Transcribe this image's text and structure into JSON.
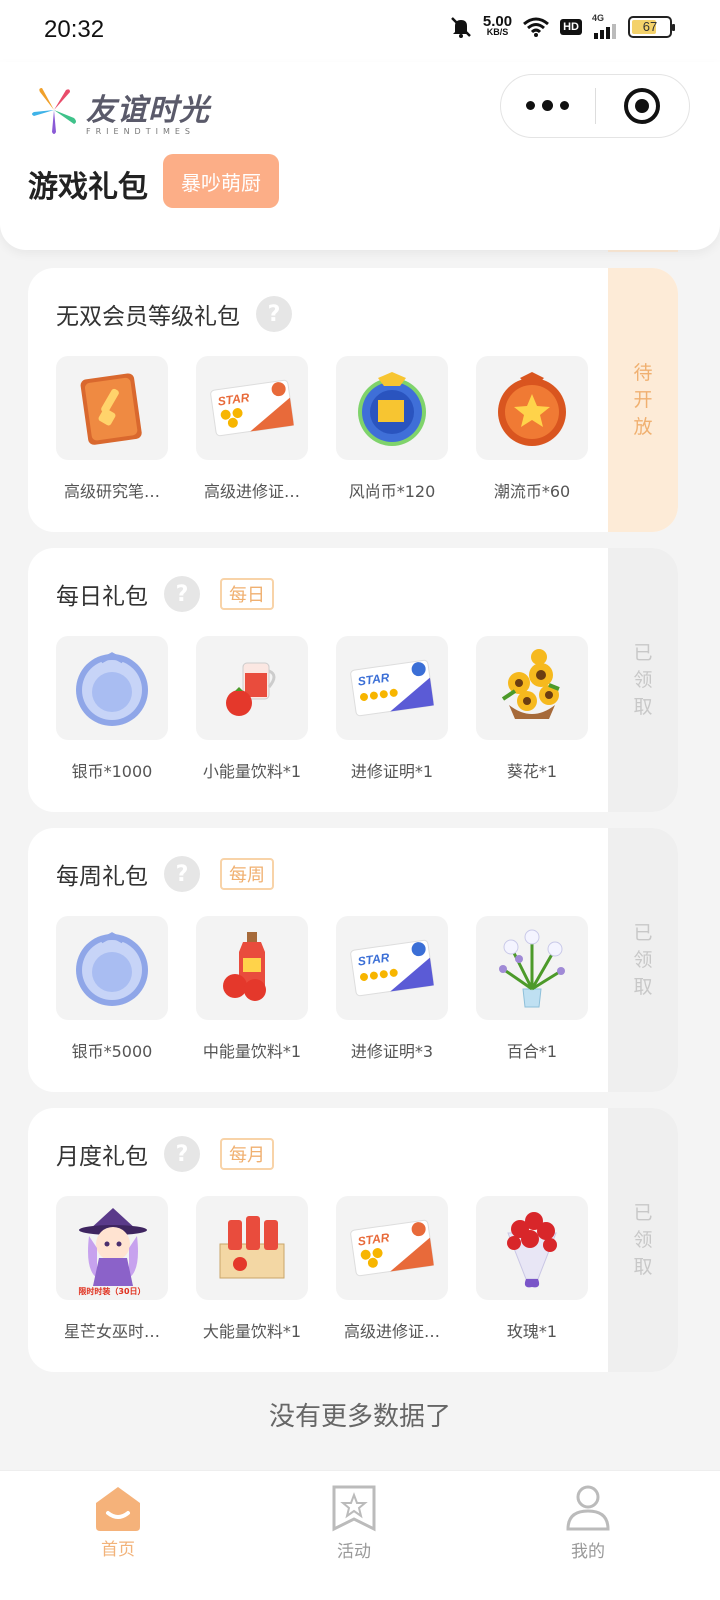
{
  "status_bar": {
    "time": "20:32",
    "net_speed_value": "5.00",
    "net_speed_unit": "KB/S",
    "hd": "HD",
    "network": "4G",
    "battery": "67"
  },
  "header": {
    "logo_cn": "友谊时光",
    "logo_en": "FRIENDTIMES",
    "page_title": "游戏礼包",
    "game_badge": "暴吵萌厨"
  },
  "colors": {
    "accent": "#fcae87",
    "tag_orange": "#f0b070",
    "open_bg": "#fdebd7",
    "done_bg": "#efefef",
    "tab_active": "#f2b37a"
  },
  "gift_packs": [
    {
      "title": "无双会员等级礼包",
      "tag": "",
      "status": [
        "待",
        "开",
        "放"
      ],
      "items": [
        {
          "icon": "research-notebook-icon",
          "label": "高级研究笔…"
        },
        {
          "icon": "advanced-certificate-icon",
          "label": "高级进修证…"
        },
        {
          "icon": "fashion-coin-icon",
          "label": "风尚币*120"
        },
        {
          "icon": "trend-coin-icon",
          "label": "潮流币*60"
        }
      ]
    },
    {
      "title": "每日礼包",
      "tag": "每日",
      "status": [
        "已",
        "领",
        "取"
      ],
      "items": [
        {
          "icon": "silver-coin-icon",
          "label": "银币*1000"
        },
        {
          "icon": "small-energy-drink-icon",
          "label": "小能量饮料*1"
        },
        {
          "icon": "certificate-icon",
          "label": "进修证明*1"
        },
        {
          "icon": "sunflower-icon",
          "label": "葵花*1"
        }
      ]
    },
    {
      "title": "每周礼包",
      "tag": "每周",
      "status": [
        "已",
        "领",
        "取"
      ],
      "items": [
        {
          "icon": "silver-coin-icon",
          "label": "银币*5000"
        },
        {
          "icon": "medium-energy-drink-icon",
          "label": "中能量饮料*1"
        },
        {
          "icon": "certificate-icon",
          "label": "进修证明*3"
        },
        {
          "icon": "lily-icon",
          "label": "百合*1"
        }
      ]
    },
    {
      "title": "月度礼包",
      "tag": "每月",
      "status": [
        "已",
        "领",
        "取"
      ],
      "items": [
        {
          "icon": "star-witch-outfit-icon",
          "label": "星芒女巫时…",
          "badge": "限时时装（30日）"
        },
        {
          "icon": "large-energy-drink-icon",
          "label": "大能量饮料*1"
        },
        {
          "icon": "advanced-certificate-icon",
          "label": "高级进修证…"
        },
        {
          "icon": "rose-bouquet-icon",
          "label": "玫瑰*1"
        }
      ]
    }
  ],
  "no_more_text": "没有更多数据了",
  "tabbar": [
    {
      "label": "首页",
      "icon": "home-icon",
      "active": true
    },
    {
      "label": "活动",
      "icon": "activity-star-icon",
      "active": false
    },
    {
      "label": "我的",
      "icon": "profile-icon",
      "active": false
    }
  ]
}
